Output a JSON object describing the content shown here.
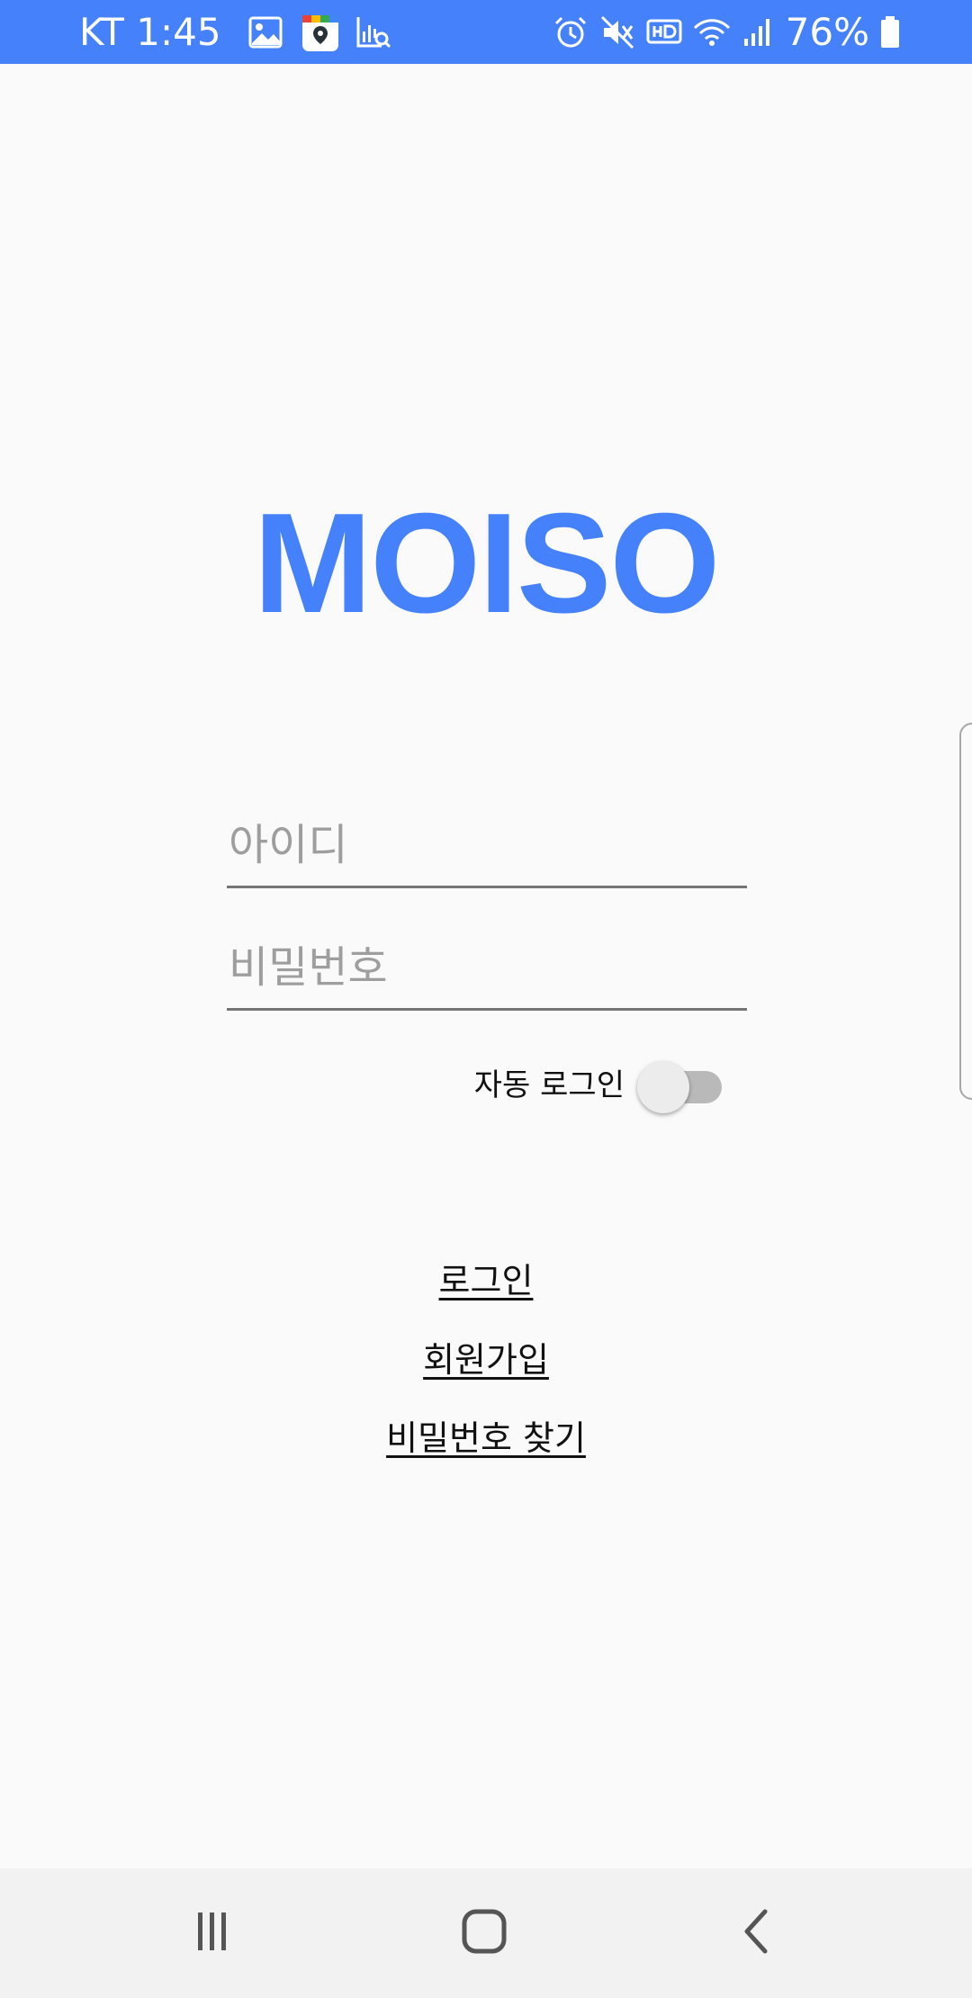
{
  "status_bar": {
    "carrier_time": "KT 1:45",
    "battery_percent": "76%",
    "background_color": "#4581fb",
    "left_icons": [
      "gallery-icon",
      "map-app-icon",
      "chart-search-icon"
    ],
    "right_icons": [
      "alarm-icon",
      "mute-icon",
      "hd-voice-icon",
      "wifi-icon",
      "signal-icon",
      "battery-icon"
    ]
  },
  "app": {
    "logo_text": "MOISO",
    "brand_color": "#4581fb"
  },
  "form": {
    "id_placeholder": "아이디",
    "id_value": "",
    "password_placeholder": "비밀번호",
    "password_value": "",
    "auto_login_label": "자동 로그인",
    "auto_login_enabled": false
  },
  "links": {
    "login": "로그인",
    "signup": "회원가입",
    "find_password": "비밀번호 찾기"
  },
  "nav_bar": {
    "buttons": [
      "recent-apps-icon",
      "home-icon",
      "back-icon"
    ]
  }
}
